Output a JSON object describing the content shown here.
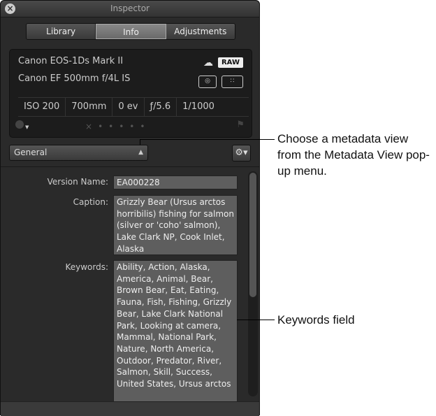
{
  "window": {
    "title": "Inspector"
  },
  "tabs": [
    {
      "label": "Library"
    },
    {
      "label": "Info"
    },
    {
      "label": "Adjustments"
    }
  ],
  "camera": {
    "model": "Canon EOS-1Ds Mark II",
    "lens": "Canon EF 500mm f/4L IS",
    "badge": "RAW"
  },
  "exif": {
    "iso": "ISO 200",
    "focal": "700mm",
    "ev": "0 ev",
    "aperture": "ƒ/5.6",
    "shutter": "1/1000"
  },
  "rating": {
    "reject": "×",
    "dots": "•••••"
  },
  "metadata_view": {
    "selected": "General"
  },
  "fields": {
    "version_label": "Version Name:",
    "version_value": "EA000228",
    "caption_label": "Caption:",
    "caption_value": "Grizzly Bear (Ursus arctos horribilis) fishing for salmon (silver or 'coho' salmon), Lake Clark NP, Cook Inlet, Alaska",
    "keywords_label": "Keywords:",
    "keywords_value": "Ability, Action, Alaska, America, Animal, Bear, Brown Bear, Eat, Eating, Fauna, Fish, Fishing, Grizzly Bear, Lake Clark National Park, Looking at camera, Mammal, National Park, Nature, North America, Outdoor, Predator, River, Salmon, Skill, Success, United States, Ursus arctos"
  },
  "callouts": {
    "metadata_view": "Choose a metadata view from the Metadata View pop-up menu.",
    "keywords": "Keywords field"
  }
}
